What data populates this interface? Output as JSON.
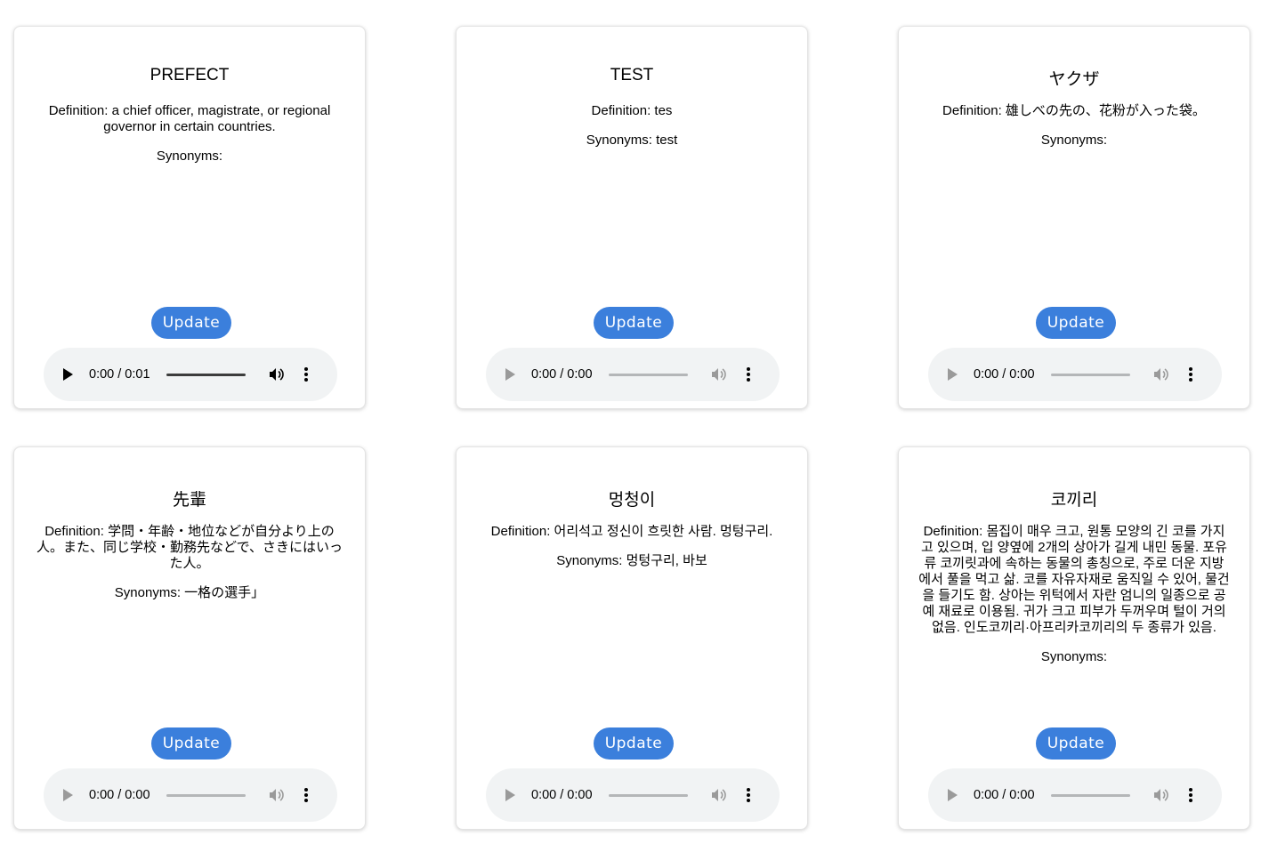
{
  "labels": {
    "definition_prefix": "Definition: ",
    "synonyms_prefix": "Synonyms: "
  },
  "cards": [
    {
      "word": "PREFECT",
      "definition": "a chief officer, magistrate, or regional governor in certain countries.",
      "synonyms": "",
      "update_label": "Update",
      "audio": {
        "time": "0:00 / 0:01",
        "progress": 0
      }
    },
    {
      "word": "TEST",
      "definition": "tes",
      "synonyms": "test",
      "update_label": "Update",
      "audio": {
        "time": "0:00 / 0:00",
        "progress": 0
      }
    },
    {
      "word": "ヤクザ",
      "definition": "雄しべの先の、花粉が入った袋。",
      "synonyms": "",
      "update_label": "Update",
      "audio": {
        "time": "0:00 / 0:00",
        "progress": 0
      }
    },
    {
      "word": "先輩",
      "definition": "学問・年齢・地位などが自分より上の人。また、同じ学校・勤務先などで、さきにはいった人。",
      "synonyms": "一格の選手」",
      "update_label": "Update",
      "audio": {
        "time": "0:00 / 0:00",
        "progress": 0
      }
    },
    {
      "word": "멍청이",
      "definition": "어리석고 정신이 흐릿한 사람. 멍텅구리.",
      "synonyms": "멍텅구리, 바보",
      "update_label": "Update",
      "audio": {
        "time": "0:00 / 0:00",
        "progress": 0
      }
    },
    {
      "word": "코끼리",
      "definition": "몸집이 매우 크고, 원통 모양의 긴 코를 가지고 있으며, 입 양옆에 2개의 상아가 길게 내민 동물. 포유류 코끼릿과에 속하는 동물의 총칭으로, 주로 더운 지방에서 풀을 먹고 삶. 코를 자유자재로 움직일 수 있어, 물건을 들기도 함. 상아는 위턱에서 자란 엄니의 일종으로 공예 재료로 이용됨. 귀가 크고 피부가 두꺼우며 털이 거의 없음. 인도코끼리·아프리카코끼리의 두 종류가 있음.",
      "synonyms": "",
      "update_label": "Update",
      "audio": {
        "time": "0:00 / 0:00",
        "progress": 0
      }
    }
  ]
}
